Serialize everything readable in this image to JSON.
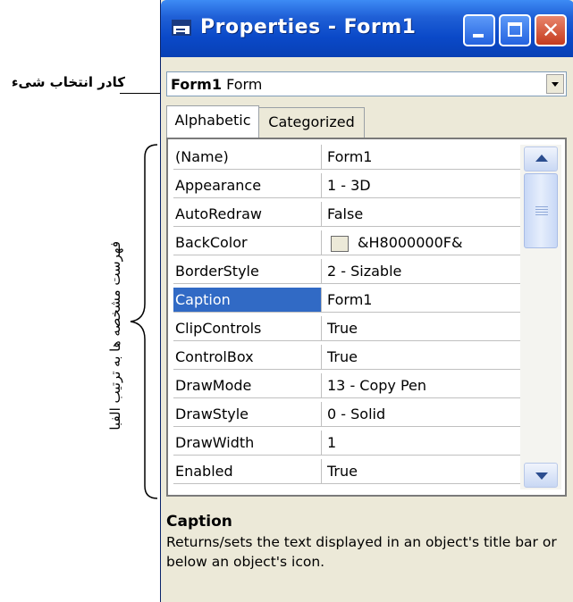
{
  "window": {
    "title": "Properties - Form1"
  },
  "selector": {
    "object_name": "Form1",
    "object_type": "Form"
  },
  "tabs": [
    {
      "label": "Alphabetic"
    },
    {
      "label": "Categorized"
    }
  ],
  "properties": [
    {
      "name": "(Name)",
      "value": "Form1"
    },
    {
      "name": "Appearance",
      "value": "1 - 3D"
    },
    {
      "name": "AutoRedraw",
      "value": "False"
    },
    {
      "name": "BackColor",
      "value": "&H8000000F&"
    },
    {
      "name": "BorderStyle",
      "value": "2 - Sizable"
    },
    {
      "name": "Caption",
      "value": "Form1"
    },
    {
      "name": "ClipControls",
      "value": "True"
    },
    {
      "name": "ControlBox",
      "value": "True"
    },
    {
      "name": "DrawMode",
      "value": "13 - Copy Pen"
    },
    {
      "name": "DrawStyle",
      "value": "0 - Solid"
    },
    {
      "name": "DrawWidth",
      "value": "1"
    },
    {
      "name": "Enabled",
      "value": "True"
    }
  ],
  "selected_property": "Caption",
  "description": {
    "title": "Caption",
    "text": "Returns/sets the text displayed in an object's title bar or below an object's icon."
  },
  "annotations": {
    "object_selector_label": "کادر انتخاب شیء",
    "property_list_label": "فهرست مشخصه ها به ترتیب الفبا"
  },
  "colors": {
    "titlebar": "#0a49c8",
    "selection": "#316ac5",
    "close_button": "#c43b1e"
  }
}
